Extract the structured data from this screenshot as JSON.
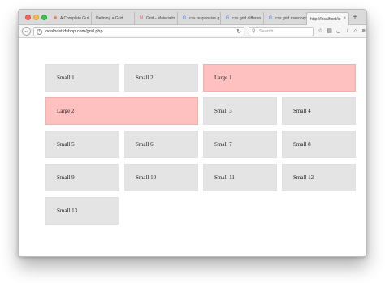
{
  "browser": {
    "tabs": [
      {
        "label": "A Complete Gui",
        "icon": "asterisk-icon",
        "active": false
      },
      {
        "label": "Defining a Grid",
        "icon": "none",
        "active": false
      },
      {
        "label": "Grid - Materializ",
        "icon": "materialize-icon",
        "active": false
      },
      {
        "label": "css responsive g",
        "icon": "google-icon",
        "active": false
      },
      {
        "label": "css grid differen",
        "icon": "google-icon",
        "active": false
      },
      {
        "label": "css grid masonry",
        "icon": "google-icon",
        "active": false
      },
      {
        "label": "http://localhost/ic",
        "icon": "none",
        "active": true
      }
    ],
    "new_tab_label": "+",
    "url": "localhost/dshop.com/grid.php",
    "search_placeholder": "Search",
    "icons": {
      "back": "back-arrow-icon",
      "info": "info-icon",
      "reload": "reload-icon",
      "search": "search-icon",
      "star": "star-icon",
      "clipboard": "clipboard-icon",
      "pocket": "pocket-icon",
      "download": "download-icon",
      "home": "home-icon",
      "menu": "hamburger-menu-icon"
    }
  },
  "grid": {
    "items": [
      {
        "label": "Small 1",
        "size": "small"
      },
      {
        "label": "Small 2",
        "size": "small"
      },
      {
        "label": "Large 1",
        "size": "large"
      },
      {
        "label": "Large 2",
        "size": "large"
      },
      {
        "label": "Small 3",
        "size": "small"
      },
      {
        "label": "Small 4",
        "size": "small"
      },
      {
        "label": "Small 5",
        "size": "small"
      },
      {
        "label": "Small 6",
        "size": "small"
      },
      {
        "label": "Small 7",
        "size": "small"
      },
      {
        "label": "Small 8",
        "size": "small"
      },
      {
        "label": "Small 9",
        "size": "small"
      },
      {
        "label": "Small 10",
        "size": "small"
      },
      {
        "label": "Small 11",
        "size": "small"
      },
      {
        "label": "Small 12",
        "size": "small"
      },
      {
        "label": "Small 13",
        "size": "small"
      }
    ]
  },
  "colors": {
    "small_bg": "#e4e4e4",
    "large_bg": "#ffc0c0",
    "close": "#fc605c",
    "minimize": "#fdbc40",
    "maximize": "#34c84a"
  }
}
